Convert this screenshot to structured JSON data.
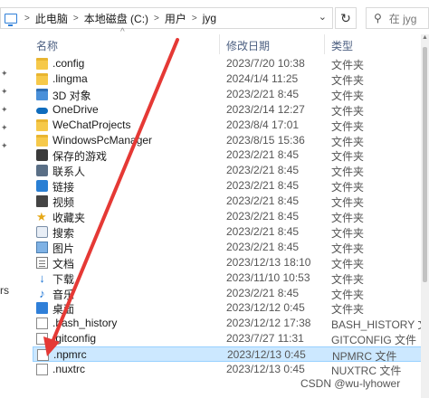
{
  "address": {
    "crumbs": [
      "此电脑",
      "本地磁盘 (C:)",
      "用户",
      "jyg"
    ],
    "separator": ">",
    "search_placeholder": "在 jyg"
  },
  "nav": {
    "visible_text": "rs"
  },
  "columns": {
    "name": "名称",
    "date": "修改日期",
    "type": "类型"
  },
  "rows": [
    {
      "name": ".config",
      "date": "2023/7/20 10:38",
      "type": "文件夹",
      "icon": "folder-icon"
    },
    {
      "name": ".lingma",
      "date": "2024/1/4 11:25",
      "type": "文件夹",
      "icon": "folder-icon"
    },
    {
      "name": "3D 对象",
      "date": "2023/2/21 8:45",
      "type": "文件夹",
      "icon": "3d-objects-icon"
    },
    {
      "name": "OneDrive",
      "date": "2023/2/14 12:27",
      "type": "文件夹",
      "icon": "onedrive-icon"
    },
    {
      "name": "WeChatProjects",
      "date": "2023/8/4 17:01",
      "type": "文件夹",
      "icon": "folder-icon"
    },
    {
      "name": "WindowsPcManager",
      "date": "2023/8/15 15:36",
      "type": "文件夹",
      "icon": "folder-icon"
    },
    {
      "name": "保存的游戏",
      "date": "2023/2/21 8:45",
      "type": "文件夹",
      "icon": "saved-games-icon"
    },
    {
      "name": "联系人",
      "date": "2023/2/21 8:45",
      "type": "文件夹",
      "icon": "contacts-icon"
    },
    {
      "name": "链接",
      "date": "2023/2/21 8:45",
      "type": "文件夹",
      "icon": "links-icon"
    },
    {
      "name": "视频",
      "date": "2023/2/21 8:45",
      "type": "文件夹",
      "icon": "videos-icon"
    },
    {
      "name": "收藏夹",
      "date": "2023/2/21 8:45",
      "type": "文件夹",
      "icon": "favorites-icon"
    },
    {
      "name": "搜索",
      "date": "2023/2/21 8:45",
      "type": "文件夹",
      "icon": "searches-icon"
    },
    {
      "name": "图片",
      "date": "2023/2/21 8:45",
      "type": "文件夹",
      "icon": "pictures-icon"
    },
    {
      "name": "文档",
      "date": "2023/12/13 18:10",
      "type": "文件夹",
      "icon": "documents-icon"
    },
    {
      "name": "下载",
      "date": "2023/11/10 10:53",
      "type": "文件夹",
      "icon": "downloads-icon"
    },
    {
      "name": "音乐",
      "date": "2023/2/21 8:45",
      "type": "文件夹",
      "icon": "music-icon"
    },
    {
      "name": "桌面",
      "date": "2023/12/12 0:45",
      "type": "文件夹",
      "icon": "desktop-icon"
    },
    {
      "name": ".bash_history",
      "date": "2023/12/12 17:38",
      "type": "BASH_HISTORY 文件",
      "icon": "file-icon"
    },
    {
      "name": ".gitconfig",
      "date": "2023/7/27 11:31",
      "type": "GITCONFIG 文件",
      "icon": "file-icon"
    },
    {
      "name": ".npmrc",
      "date": "2023/12/13 0:45",
      "type": "NPMRC 文件",
      "icon": "file-icon",
      "selected": true
    },
    {
      "name": ".nuxtrc",
      "date": "2023/12/13 0:45",
      "type": "NUXTRC 文件",
      "icon": "file-icon"
    }
  ],
  "watermark": "CSDN @wu-lyhower",
  "colors": {
    "selection_bg": "#cce8ff",
    "arrow": "#e53935",
    "header_text": "#4d6082"
  }
}
